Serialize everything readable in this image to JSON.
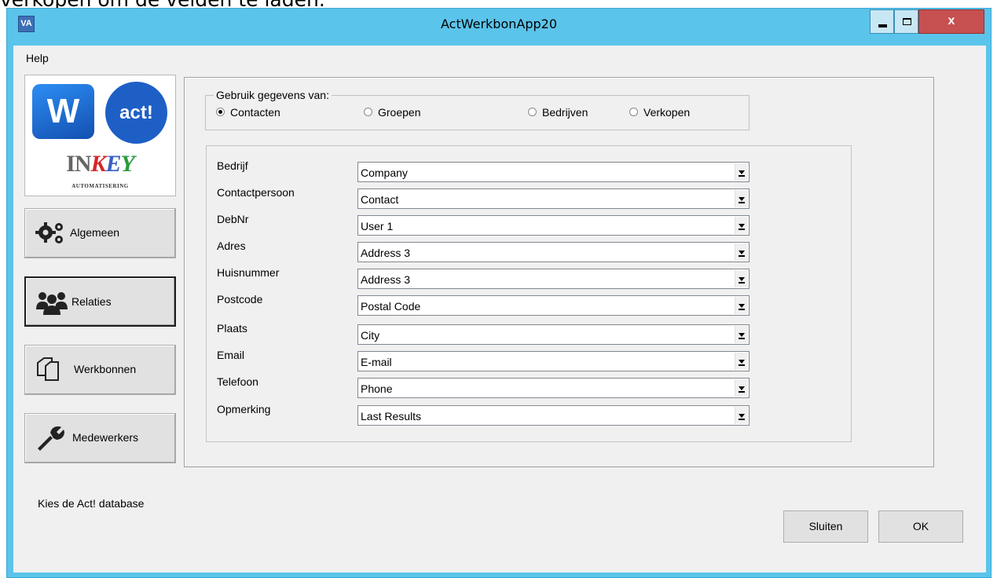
{
  "page_text": "verkopen om de velden te laden.",
  "window": {
    "title": "ActWerkbonApp20",
    "icon_label": "VA",
    "close_label": "x"
  },
  "menu": {
    "help": "Help"
  },
  "logo": {
    "w_letter": "W",
    "act_text": "act!",
    "inkey_in": "IN",
    "inkey_k": "K",
    "inkey_e": "E",
    "inkey_y": "Y",
    "subtitle": "AUTOMATISERING"
  },
  "nav": [
    {
      "label": "Algemeen",
      "icon": "gears-icon"
    },
    {
      "label": "Relaties",
      "icon": "people-icon"
    },
    {
      "label": "Werkbonnen",
      "icon": "documents-icon"
    },
    {
      "label": "Medewerkers",
      "icon": "wrench-icon"
    }
  ],
  "source_group": {
    "legend": "Gebruik gegevens van:",
    "options": [
      "Contacten",
      "Groepen",
      "Bedrijven",
      "Verkopen"
    ],
    "selected": "Contacten"
  },
  "fields": [
    {
      "label": "Bedrijf",
      "value": "Company"
    },
    {
      "label": "Contactpersoon",
      "value": "Contact"
    },
    {
      "label": "DebNr",
      "value": "User 1"
    },
    {
      "label": "Adres",
      "value": "Address 3"
    },
    {
      "label": "Huisnummer",
      "value": "Address 3"
    },
    {
      "label": "Postcode",
      "value": "Postal Code"
    },
    {
      "label": "Plaats",
      "value": "City"
    },
    {
      "label": "Email",
      "value": "E-mail"
    },
    {
      "label": "Telefoon",
      "value": "Phone"
    },
    {
      "label": "Opmerking",
      "value": "Last Results"
    }
  ],
  "status_text": "Kies de Act! database",
  "buttons": {
    "sluiten": "Sluiten",
    "ok": "OK"
  },
  "colors": {
    "titlebar": "#5bc4ea",
    "close": "#c75050",
    "client": "#f0f0f0"
  }
}
